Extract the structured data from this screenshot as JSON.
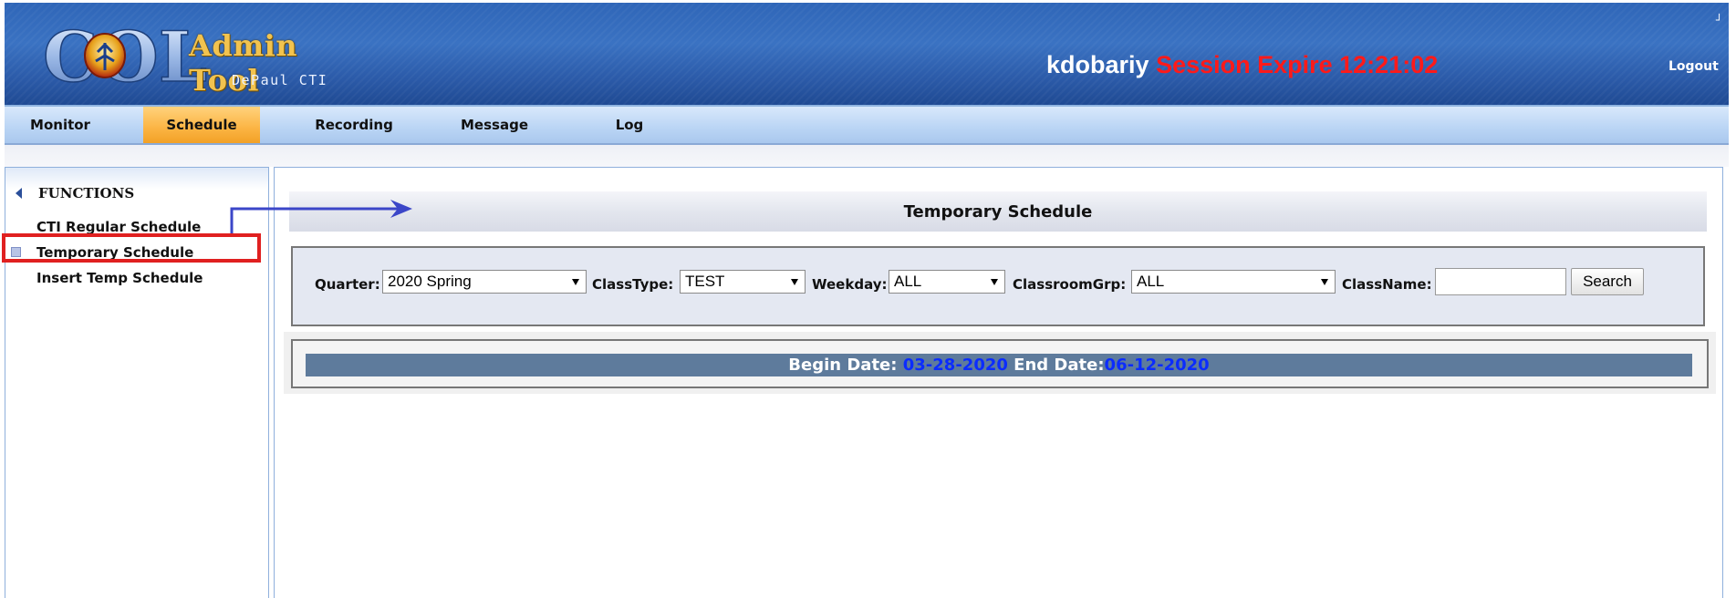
{
  "header": {
    "logo_letters": "COL",
    "logo_title": "Admin Tool",
    "logo_subtitle": "DePaul CTI",
    "username": "kdobariy",
    "session_text": "Session Expire 12:21:02",
    "logout_label": "Logout"
  },
  "nav": {
    "tabs": [
      {
        "label": "Monitor"
      },
      {
        "label": "Schedule",
        "active": true
      },
      {
        "label": "Recording"
      },
      {
        "label": "Message"
      },
      {
        "label": "Log"
      }
    ]
  },
  "sidebar": {
    "title": "FUNCTIONS",
    "items": [
      {
        "label": "CTI Regular Schedule"
      },
      {
        "label": "Temporary Schedule",
        "selected": true
      },
      {
        "label": "Insert Temp Schedule"
      }
    ]
  },
  "main": {
    "page_title": "Temporary Schedule",
    "filters": {
      "quarter_label": "Quarter:",
      "quarter_value": "2020 Spring",
      "classtype_label": "ClassType:",
      "classtype_value": "TEST",
      "weekday_label": "Weekday:",
      "weekday_value": "ALL",
      "classroomgrp_label": "ClassroomGrp:",
      "classroomgrp_value": "ALL",
      "classname_label": "ClassName:",
      "classname_value": "",
      "search_label": "Search"
    },
    "dates": {
      "begin_label": "Begin Date:",
      "begin_value": "03-28-2020",
      "end_label": "End Date:",
      "end_value": "06-12-2020"
    }
  },
  "colors": {
    "header_blue": "#2f66b8",
    "active_tab": "#fbb443",
    "session_red": "#ff1a1a",
    "date_bar": "#5e7b9c",
    "date_value_blue": "#0b2cff",
    "highlight_red": "#e02020",
    "annotation_arrow": "#3b46c8"
  },
  "icons": [
    "logo-emblem",
    "collapse-triangle-icon",
    "bullet-icon",
    "dropdown-caret-icon",
    "annotation-arrow"
  ]
}
